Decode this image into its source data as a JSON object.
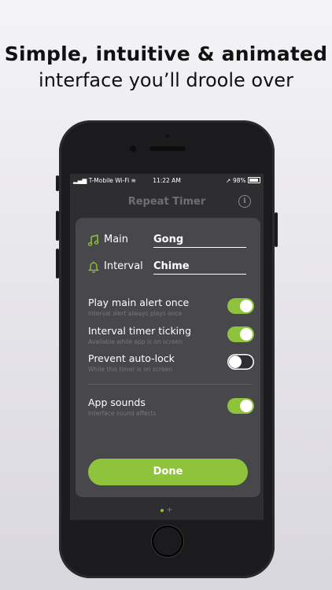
{
  "headline": {
    "line1": "Simple, intuitive & animated",
    "line2": "interface you’ll droole over"
  },
  "status_bar": {
    "carrier": "T-Mobile Wi-Fi",
    "time": "11:22 AM",
    "battery": "98%"
  },
  "nav": {
    "title": "Repeat Timer",
    "info_icon": "info-icon"
  },
  "fields": {
    "main": {
      "label": "Main",
      "value": "Gong",
      "icon": "music-note-icon"
    },
    "interval": {
      "label": "Interval",
      "value": "Chime",
      "icon": "bell-icon"
    }
  },
  "toggles": {
    "play_main": {
      "label": "Play main alert once",
      "sub": "Interval alert always plays once",
      "on": true
    },
    "ticking": {
      "label": "Interval timer ticking",
      "sub": "Available while app is on screen",
      "on": true
    },
    "autolock": {
      "label": "Prevent auto-lock",
      "sub": "While this timer is on screen",
      "on": false
    },
    "sounds": {
      "label": "App sounds",
      "sub": "Interface sound effects",
      "on": true
    }
  },
  "done_label": "Done",
  "pager": {
    "plus": "+"
  },
  "colors": {
    "accent": "#8fc33b",
    "card": "#48484c",
    "screen": "#2e2e31"
  }
}
